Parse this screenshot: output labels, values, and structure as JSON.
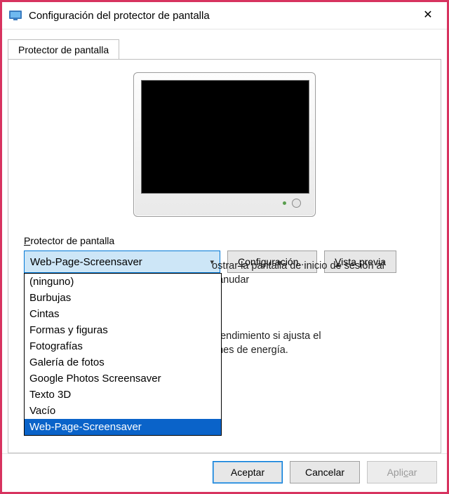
{
  "window": {
    "title": "Configuración del protector de pantalla"
  },
  "tab": {
    "label": "Protector de pantalla"
  },
  "group": {
    "label_prefix": "P",
    "label_rest": "rotector de pantalla"
  },
  "combo": {
    "selected": "Web-Page-Screensaver",
    "options": [
      "(ninguno)",
      "Burbujas",
      "Cintas",
      "Formas y figuras",
      "Fotografías",
      "Galería de fotos",
      "Google Photos Screensaver",
      "Texto 3D",
      "Vacío",
      "Web-Page-Screensaver"
    ]
  },
  "buttons": {
    "config_prefix": "C",
    "config_rest": "onfiguración...",
    "preview_prefix": "V",
    "preview_rest": "ista previa"
  },
  "background_text": {
    "line1": "ostrar la pantalla de inicio de sesión al",
    "line2": "eanudar",
    "line3": "l rendimiento si ajusta el",
    "line4": "ones de energía."
  },
  "footer": {
    "ok": "Aceptar",
    "cancel": "Cancelar",
    "apply_prefix": "Apli",
    "apply_u": "c",
    "apply_rest": "ar"
  }
}
